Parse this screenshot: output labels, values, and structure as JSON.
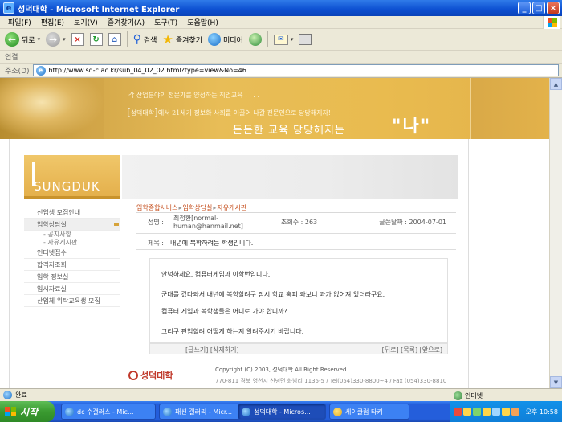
{
  "window": {
    "title": "성덕대학 - Microsoft Internet Explorer"
  },
  "menu": [
    "파일(F)",
    "편집(E)",
    "보기(V)",
    "즐겨찾기(A)",
    "도구(T)",
    "도움말(H)"
  ],
  "toolbar": {
    "back_label": "뒤로",
    "search_label": "검색",
    "favorites_label": "즐겨찾기",
    "media_label": "미디어"
  },
  "links_label": "연결",
  "address": {
    "label": "주소(D)",
    "url": "http://www.sd-c.ac.kr/sub_04_02_02.html?type=view&No=46"
  },
  "banner": {
    "tagline": "각 산업분야의 전문가를 양성하는 직업교육 . . . .",
    "brand": "성덕대학",
    "brand_text": "에서 21세기 정보화 사회를 이끌어 나갈 전문인으로 당당해지자!",
    "slogan": "든든한 교육 당당해지는",
    "slogan_big": "\"나\""
  },
  "logo": "SUNGDUK",
  "nav": {
    "items": [
      {
        "label": "신입생 모집안내"
      },
      {
        "label": "입학상담실"
      },
      {
        "label": "인터넷접수"
      },
      {
        "label": "합격자조회"
      },
      {
        "label": "입학 정보실"
      },
      {
        "label": "입시자료실"
      },
      {
        "label": "산업체 위탁교육생 모집"
      }
    ],
    "sub_items": [
      "- 공지사항",
      "- 자유게시판"
    ]
  },
  "breadcrumb": {
    "a": "입학종합서비스",
    "b": "입학상담실",
    "c": "자유게시판",
    "sep": "▸"
  },
  "post": {
    "author_label": "성명 :",
    "author": "최정환[normal-human@hanmail.net]",
    "views": "조회수 : 263",
    "date": "글쓴날짜 : 2004-07-01",
    "subject_label": "제목 :",
    "subject": "내년에 복학하려는 학생입니다.",
    "body": [
      "안녕하세요. 컴퓨터게임과 이학번입니다.",
      "군대를 갔다와서 내년에 복학할려구 잠시 학교 홈피 와보니 과가 없어져 있더라구요.",
      "컴퓨터 게임과 복학생들은 어디로 가야 합니까?",
      "그리구 편입할려 어떻게 하는지 알려주시기 바랍니다."
    ]
  },
  "actions": {
    "left": "[글쓰기] [삭제하기]",
    "right": "[뒤로] [목록] [앞으로]"
  },
  "footer": {
    "school": "성덕대학",
    "copyright": "Copyright (C) 2003, 성덕대학 All Right Reserved",
    "address": "770-811 경북 영천시 신녕면 화남리 1135-5 / Tel(054)330-8800~4 / Fax (054)330-8810"
  },
  "status": {
    "text": "완료",
    "zone": "인터넷"
  },
  "taskbar": {
    "start": "시작",
    "tasks": [
      "dc 수갤러스 - Mic...",
      "패션 갤러리 - Micr...",
      "성덕대학 - Micros...",
      "세이클럽 타키"
    ],
    "clock": "오후 10:58"
  }
}
